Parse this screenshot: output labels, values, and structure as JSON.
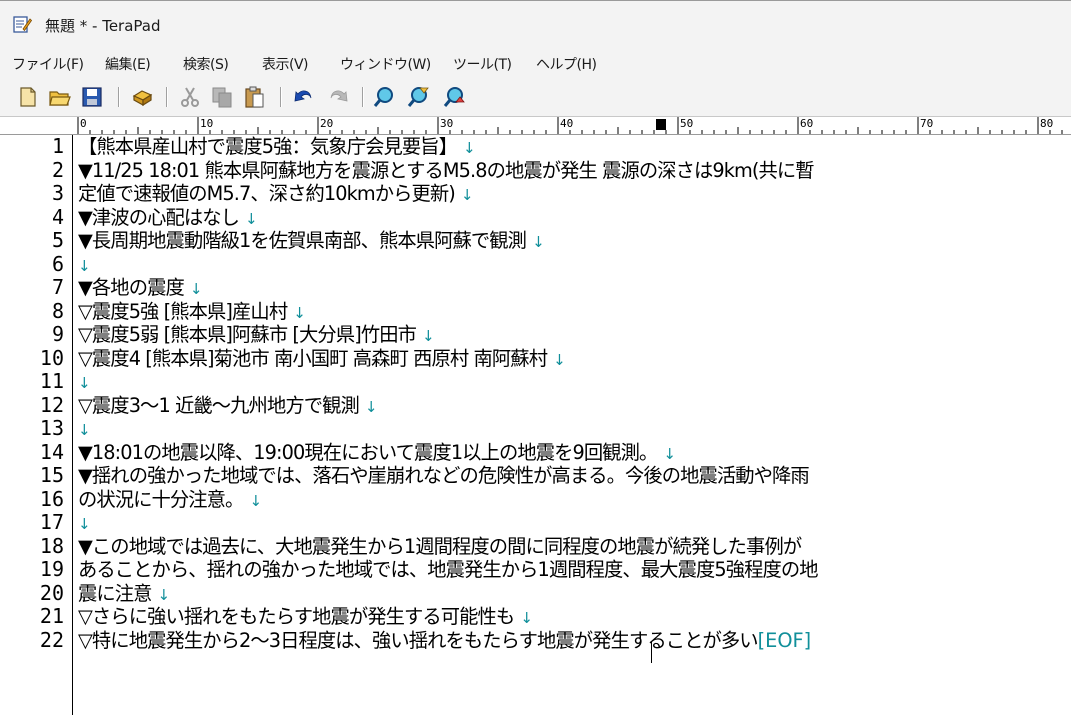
{
  "window": {
    "title": "無題 * - TeraPad"
  },
  "menu": [
    {
      "label": "ファイル(F)"
    },
    {
      "label": "編集(E)"
    },
    {
      "label": "検索(S)"
    },
    {
      "label": "表示(V)"
    },
    {
      "label": "ウィンドウ(W)"
    },
    {
      "label": "ツール(T)"
    },
    {
      "label": "ヘルプ(H)"
    }
  ],
  "toolbar": {
    "buttons": [
      "new-file-icon",
      "open-folder-icon",
      "save-icon",
      "print-icon",
      "cut-icon",
      "copy-icon",
      "paste-icon",
      "undo-icon",
      "redo-icon",
      "find-icon",
      "find-next-icon",
      "find-prev-icon"
    ]
  },
  "ruler": {
    "marks": [
      "0",
      "10",
      "20",
      "30",
      "40",
      "50",
      "60",
      "70",
      "80"
    ]
  },
  "editor": {
    "newline_glyph": "↓",
    "eof_marker": "[EOF]",
    "lines": [
      {
        "n": "1",
        "text": "【熊本県産山村で震度5強：気象庁会見要旨】",
        "nl": true
      },
      {
        "n": "2",
        "text": "▼11/25 18:01 熊本県阿蘇地方を震源とするM5.8の地震が発生 震源の深さは9km(共に暫",
        "nl": false
      },
      {
        "n": "3",
        "text": "定値で速報値のM5.7、深さ約10kmから更新)",
        "nl": true
      },
      {
        "n": "4",
        "text": "▼津波の心配はなし",
        "nl": true
      },
      {
        "n": "5",
        "text": "▼長周期地震動階級1を佐賀県南部、熊本県阿蘇で観測",
        "nl": true
      },
      {
        "n": "6",
        "text": "",
        "nl": true
      },
      {
        "n": "7",
        "text": "▼各地の震度",
        "nl": true
      },
      {
        "n": "8",
        "text": "▽震度5強 [熊本県]産山村",
        "nl": true
      },
      {
        "n": "9",
        "text": "▽震度5弱 [熊本県]阿蘇市 [大分県]竹田市",
        "nl": true
      },
      {
        "n": "10",
        "text": "▽震度4 [熊本県]菊池市 南小国町 高森町 西原村 南阿蘇村",
        "nl": true
      },
      {
        "n": "11",
        "text": "",
        "nl": true
      },
      {
        "n": "12",
        "text": "▽震度3～1 近畿～九州地方で観測",
        "nl": true
      },
      {
        "n": "13",
        "text": "",
        "nl": true
      },
      {
        "n": "14",
        "text": "▼18:01の地震以降、19:00現在において震度1以上の地震を9回観測。",
        "nl": true
      },
      {
        "n": "15",
        "text": "▼揺れの強かった地域では、落石や崖崩れなどの危険性が高まる。今後の地震活動や降雨",
        "nl": false
      },
      {
        "n": "16",
        "text": "の状況に十分注意。",
        "nl": true
      },
      {
        "n": "17",
        "text": "",
        "nl": true
      },
      {
        "n": "18",
        "text": "▼この地域では過去に、大地震発生から1週間程度の間に同程度の地震が続発した事例が",
        "nl": false
      },
      {
        "n": "19",
        "text": "あることから、揺れの強かった地域では、地震発生から1週間程度、最大震度5強程度の地",
        "nl": false
      },
      {
        "n": "20",
        "text": "震に注意",
        "nl": true
      },
      {
        "n": "21",
        "text": "▽さらに強い揺れをもたらす地震が発生する可能性も",
        "nl": true
      },
      {
        "n": "22",
        "text": "▽特に地震発生から2～3日程度は、強い揺れをもたらす地震が発生することが多い",
        "nl": false,
        "eof": true
      }
    ]
  }
}
